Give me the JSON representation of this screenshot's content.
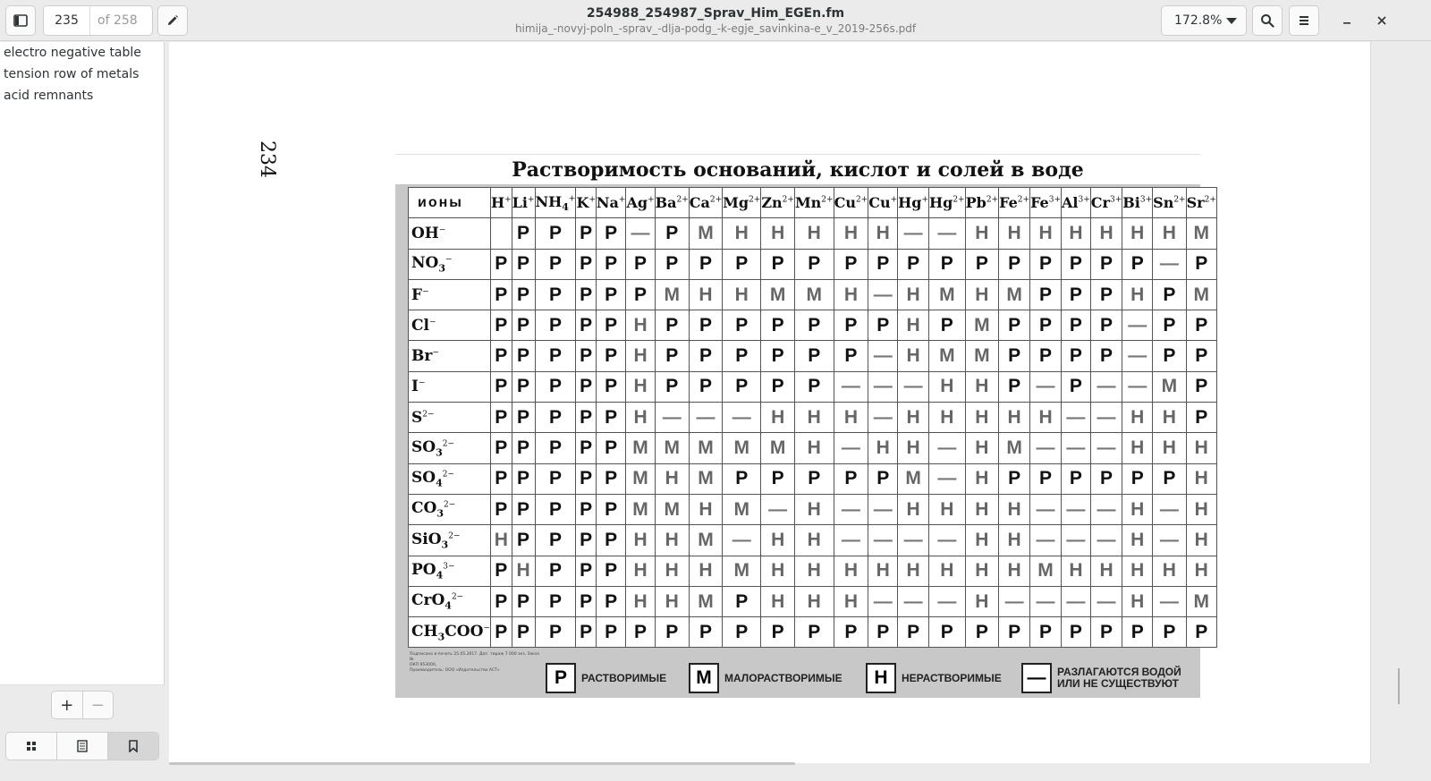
{
  "header": {
    "page_current": "235",
    "page_of": "of 258",
    "title": "254988_254987_Sprav_Him_EGEn.fm",
    "subtitle": "himija_-novyj-poln_-sprav_-dlja-podg_-k-egje_savinkina-e_v_2019-256s.pdf",
    "zoom": "172.8%"
  },
  "sidebar": {
    "bookmarks": [
      "electro negative table",
      "tension row of metals",
      "acid remnants"
    ]
  },
  "document": {
    "page_number": "234",
    "table_title": "Растворимость оснований, кислот и солей в воде",
    "corner_label": "ионы",
    "cations": [
      {
        "base": "H",
        "ch": "+"
      },
      {
        "base": "Li",
        "ch": "+"
      },
      {
        "base": "NH",
        "sub": "4",
        "ch": "+"
      },
      {
        "base": "K",
        "ch": "+"
      },
      {
        "base": "Na",
        "ch": "+"
      },
      {
        "base": "Ag",
        "ch": "+"
      },
      {
        "base": "Ba",
        "ch": "2+"
      },
      {
        "base": "Ca",
        "ch": "2+"
      },
      {
        "base": "Mg",
        "ch": "2+"
      },
      {
        "base": "Zn",
        "ch": "2+"
      },
      {
        "base": "Mn",
        "ch": "2+"
      },
      {
        "base": "Cu",
        "ch": "2+"
      },
      {
        "base": "Cu",
        "ch": "+"
      },
      {
        "base": "Hg",
        "ch": "+"
      },
      {
        "base": "Hg",
        "ch": "2+"
      },
      {
        "base": "Pb",
        "ch": "2+"
      },
      {
        "base": "Fe",
        "ch": "2+"
      },
      {
        "base": "Fe",
        "ch": "3+"
      },
      {
        "base": "Al",
        "ch": "3+"
      },
      {
        "base": "Cr",
        "ch": "3+"
      },
      {
        "base": "Bi",
        "ch": "3+"
      },
      {
        "base": "Sn",
        "ch": "2+"
      },
      {
        "base": "Sr",
        "ch": "2+"
      }
    ],
    "anions": [
      {
        "base": "OH",
        "ch": "−",
        "cells": [
          "",
          "Р",
          "Р",
          "Р",
          "Р",
          "—",
          "Р",
          "М",
          "Н",
          "Н",
          "Н",
          "Н",
          "Н",
          "—",
          "—",
          "Н",
          "Н",
          "Н",
          "Н",
          "Н",
          "Н",
          "Н",
          "М"
        ]
      },
      {
        "base": "NO",
        "sub": "3",
        "ch": "−",
        "cells": [
          "Р",
          "Р",
          "Р",
          "Р",
          "Р",
          "Р",
          "Р",
          "Р",
          "Р",
          "Р",
          "Р",
          "Р",
          "Р",
          "Р",
          "Р",
          "Р",
          "Р",
          "Р",
          "Р",
          "Р",
          "Р",
          "—",
          "Р"
        ]
      },
      {
        "base": "F",
        "ch": "−",
        "cells": [
          "Р",
          "Р",
          "Р",
          "Р",
          "Р",
          "Р",
          "М",
          "Н",
          "Н",
          "М",
          "М",
          "Н",
          "—",
          "Н",
          "М",
          "Н",
          "М",
          "Р",
          "Р",
          "Р",
          "Н",
          "Р",
          "М"
        ]
      },
      {
        "base": "Cl",
        "ch": "−",
        "cells": [
          "Р",
          "Р",
          "Р",
          "Р",
          "Р",
          "Н",
          "Р",
          "Р",
          "Р",
          "Р",
          "Р",
          "Р",
          "Р",
          "Н",
          "Р",
          "М",
          "Р",
          "Р",
          "Р",
          "Р",
          "—",
          "Р",
          "Р"
        ]
      },
      {
        "base": "Br",
        "ch": "−",
        "cells": [
          "Р",
          "Р",
          "Р",
          "Р",
          "Р",
          "Н",
          "Р",
          "Р",
          "Р",
          "Р",
          "Р",
          "Р",
          "—",
          "Н",
          "М",
          "М",
          "Р",
          "Р",
          "Р",
          "Р",
          "—",
          "Р",
          "Р"
        ]
      },
      {
        "base": "I",
        "ch": "−",
        "cells": [
          "Р",
          "Р",
          "Р",
          "Р",
          "Р",
          "Н",
          "Р",
          "Р",
          "Р",
          "Р",
          "Р",
          "—",
          "—",
          "—",
          "Н",
          "Н",
          "Р",
          "—",
          "Р",
          "—",
          "—",
          "М",
          "Р"
        ]
      },
      {
        "base": "S",
        "ch": "2−",
        "cells": [
          "Р",
          "Р",
          "Р",
          "Р",
          "Р",
          "Н",
          "—",
          "—",
          "—",
          "Н",
          "Н",
          "Н",
          "—",
          "Н",
          "Н",
          "Н",
          "Н",
          "Н",
          "—",
          "—",
          "Н",
          "Н",
          "Р"
        ]
      },
      {
        "base": "SO",
        "sub": "3",
        "ch": "2−",
        "cells": [
          "Р",
          "Р",
          "Р",
          "Р",
          "Р",
          "М",
          "М",
          "М",
          "М",
          "М",
          "Н",
          "—",
          "Н",
          "Н",
          "—",
          "Н",
          "М",
          "—",
          "—",
          "—",
          "Н",
          "Н",
          "Н"
        ]
      },
      {
        "base": "SO",
        "sub": "4",
        "ch": "2−",
        "cells": [
          "Р",
          "Р",
          "Р",
          "Р",
          "Р",
          "М",
          "Н",
          "М",
          "Р",
          "Р",
          "Р",
          "Р",
          "Р",
          "М",
          "—",
          "Н",
          "Р",
          "Р",
          "Р",
          "Р",
          "Р",
          "Р",
          "Н"
        ]
      },
      {
        "base": "CO",
        "sub": "3",
        "ch": "2−",
        "cells": [
          "Р",
          "Р",
          "Р",
          "Р",
          "Р",
          "М",
          "М",
          "Н",
          "М",
          "—",
          "Н",
          "—",
          "—",
          "Н",
          "Н",
          "Н",
          "Н",
          "—",
          "—",
          "—",
          "Н",
          "—",
          "Н"
        ]
      },
      {
        "base": "SiO",
        "sub": "3",
        "ch": "2−",
        "cells": [
          "Н",
          "Р",
          "Р",
          "Р",
          "Р",
          "Н",
          "Н",
          "М",
          "—",
          "Н",
          "Н",
          "—",
          "—",
          "—",
          "—",
          "Н",
          "Н",
          "—",
          "—",
          "—",
          "Н",
          "—",
          "Н"
        ]
      },
      {
        "base": "PO",
        "sub": "4",
        "ch": "3−",
        "cells": [
          "Р",
          "Н",
          "Р",
          "Р",
          "Р",
          "Н",
          "Н",
          "Н",
          "М",
          "Н",
          "Н",
          "Н",
          "Н",
          "Н",
          "Н",
          "Н",
          "Н",
          "М",
          "Н",
          "Н",
          "Н",
          "Н",
          "Н"
        ]
      },
      {
        "base": "CrO",
        "sub": "4",
        "ch": "2−",
        "cells": [
          "Р",
          "Р",
          "Р",
          "Р",
          "Р",
          "Н",
          "Н",
          "М",
          "Р",
          "Н",
          "Н",
          "Н",
          "—",
          "—",
          "—",
          "Н",
          "—",
          "—",
          "—",
          "—",
          "Н",
          "—",
          "М"
        ]
      },
      {
        "base": "CH",
        "sub": "3",
        "tail": "COO",
        "ch": "−",
        "cells": [
          "Р",
          "Р",
          "Р",
          "Р",
          "Р",
          "Р",
          "Р",
          "Р",
          "Р",
          "Р",
          "Р",
          "Р",
          "Р",
          "Р",
          "Р",
          "Р",
          "Р",
          "Р",
          "Р",
          "Р",
          "Р",
          "Р",
          "Р"
        ]
      }
    ],
    "fine_print": [
      "Подписано в печать 25.05.2017. Доп. тираж 7 000 экз. Заказ №",
      "ОКП 953000,",
      "Производитель: ООО «Издательство АСТ»"
    ],
    "legend": [
      {
        "symbol": "Р",
        "text": "РАСТВОРИМЫЕ"
      },
      {
        "symbol": "М",
        "text": "МАЛОРАСТВОРИМЫЕ"
      },
      {
        "symbol": "Н",
        "text": "НЕРАСТВОРИМЫЕ"
      },
      {
        "symbol": "—",
        "text": "РАЗЛАГАЮТСЯ ВОДОЙ ИЛИ НЕ СУЩЕСТВУЮТ"
      }
    ]
  }
}
